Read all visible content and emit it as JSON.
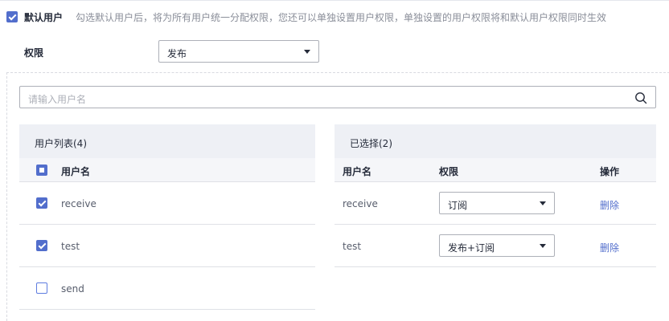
{
  "default_user": {
    "checked": true,
    "label": "默认用户",
    "hint": "勾选默认用户后，将为所有用户统一分配权限，您还可以单独设置用户权限，单独设置的用户权限将和默认用户权限同时生效"
  },
  "permission": {
    "label": "权限",
    "value": "发布"
  },
  "search": {
    "placeholder": "请输入用户名"
  },
  "user_list": {
    "title": "用户列表(4)",
    "column_username": "用户名",
    "rows": [
      {
        "name": "receive",
        "checked": true
      },
      {
        "name": "test",
        "checked": true
      },
      {
        "name": "send",
        "checked": false
      }
    ]
  },
  "selected": {
    "title": "已选择(2)",
    "columns": {
      "username": "用户名",
      "permission": "权限",
      "action": "操作"
    },
    "rows": [
      {
        "name": "receive",
        "permission": "订阅",
        "action": "删除"
      },
      {
        "name": "test",
        "permission": "发布+订阅",
        "action": "删除"
      }
    ]
  },
  "colors": {
    "accent": "#526ecc",
    "panel_header": "#eef0f5",
    "table_header": "#f5f6f9"
  }
}
